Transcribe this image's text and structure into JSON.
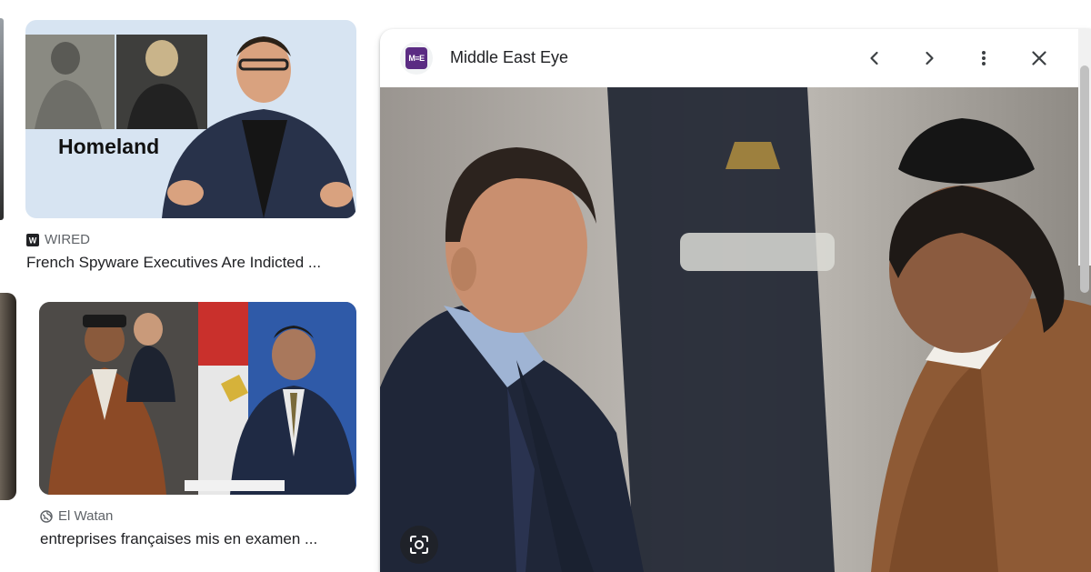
{
  "results": [
    {
      "source": "WIRED",
      "source_icon": "wired-logo-icon",
      "title": "French Spyware Executives Are Indicted ...",
      "image_caption": "Homeland"
    },
    {
      "source": "El Watan",
      "source_icon": "globe-icon",
      "title": "entreprises françaises mis en examen ..."
    }
  ],
  "viewer": {
    "site_name": "Middle East Eye",
    "logo_text": "M≡E",
    "buttons": {
      "prev": "chevron-left-icon",
      "next": "chevron-right-icon",
      "more": "more-vert-icon",
      "close": "close-icon",
      "lens": "google-lens-icon"
    }
  },
  "colors": {
    "accent_purple": "#5b2c83",
    "text_primary": "#202124",
    "text_secondary": "#5f6368"
  }
}
